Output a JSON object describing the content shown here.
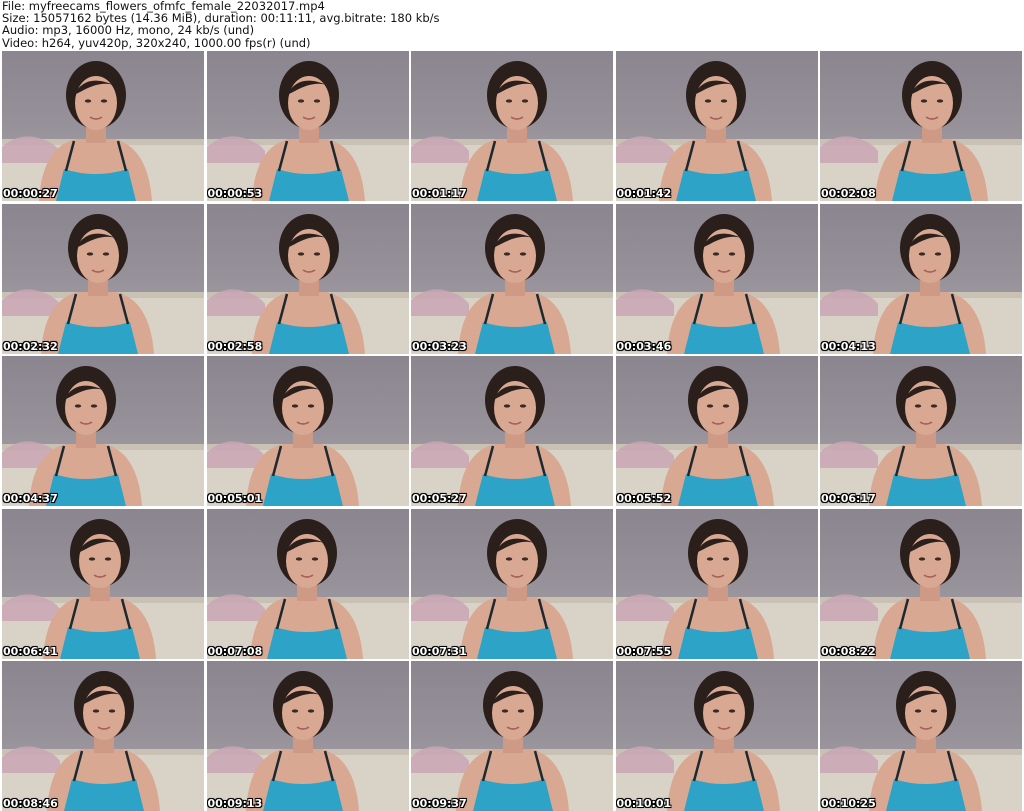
{
  "header": {
    "file_line": "File: myfreecams_flowers_ofmfc_female_22032017.mp4",
    "size_line": "Size: 15057162 bytes (14.36 MiB), duration: 00:11:11, avg.bitrate: 180 kb/s",
    "audio_line": "Audio: mp3, 16000 Hz, mono, 24 kb/s (und)",
    "video_line": "Video: h264, yuv420p, 320x240, 1000.00 fps(r) (und)"
  },
  "thumbnails": [
    {
      "timestamp": "00:00:27"
    },
    {
      "timestamp": "00:00:53"
    },
    {
      "timestamp": "00:01:17"
    },
    {
      "timestamp": "00:01:42"
    },
    {
      "timestamp": "00:02:08"
    },
    {
      "timestamp": "00:02:32"
    },
    {
      "timestamp": "00:02:58"
    },
    {
      "timestamp": "00:03:23"
    },
    {
      "timestamp": "00:03:46"
    },
    {
      "timestamp": "00:04:13"
    },
    {
      "timestamp": "00:04:37"
    },
    {
      "timestamp": "00:05:01"
    },
    {
      "timestamp": "00:05:27"
    },
    {
      "timestamp": "00:05:52"
    },
    {
      "timestamp": "00:06:17"
    },
    {
      "timestamp": "00:06:41"
    },
    {
      "timestamp": "00:07:08"
    },
    {
      "timestamp": "00:07:31"
    },
    {
      "timestamp": "00:07:55"
    },
    {
      "timestamp": "00:08:22"
    },
    {
      "timestamp": "00:08:46"
    },
    {
      "timestamp": "00:09:13"
    },
    {
      "timestamp": "00:09:37"
    },
    {
      "timestamp": "00:10:01"
    },
    {
      "timestamp": "00:10:25"
    }
  ],
  "colors": {
    "background": "#ffffff",
    "header_text": "#111111",
    "timestamp_text": "#ffffff",
    "timestamp_outline": "#000000",
    "frame_wall": "#948f97",
    "frame_sofa": "#d9d3c7",
    "frame_top": "#2ea3c8",
    "frame_skin": "#d9a892",
    "frame_hair": "#2b1f1c"
  }
}
